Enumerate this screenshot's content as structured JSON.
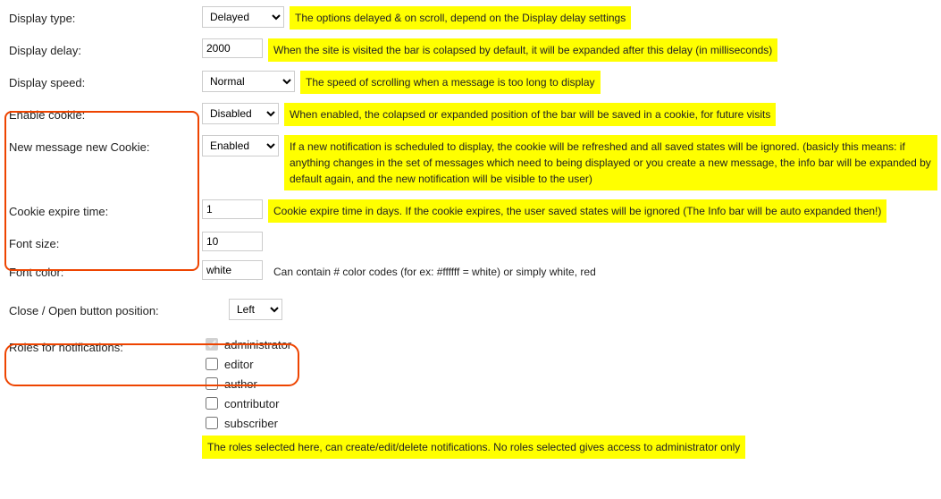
{
  "rows": {
    "displayType": {
      "label": "Display type:",
      "value": "Delayed",
      "hint": "The options delayed & on scroll, depend on the Display delay settings"
    },
    "displayDelay": {
      "label": "Display delay:",
      "value": "2000",
      "hint": "When the site is visited the bar is colapsed by default, it will be expanded after this delay (in milliseconds)"
    },
    "displaySpeed": {
      "label": "Display speed:",
      "value": "Normal",
      "hint": "The speed of scrolling when a message is too long to display"
    },
    "enableCookie": {
      "label": "Enable cookie:",
      "value": "Disabled",
      "hint": "When enabled, the colapsed or expanded position of the bar will be saved in a cookie, for future visits"
    },
    "newMsgCookie": {
      "label": "New message new Cookie:",
      "value": "Enabled",
      "hint": "If a new notification is scheduled to display, the cookie will be refreshed and all saved states will be ignored. (basicly this means: if anything changes in the set of messages which need to being displayed or you create a new message, the info bar will be expanded by default again, and the new notification will be visible to the user)"
    },
    "cookieExpire": {
      "label": "Cookie expire time:",
      "value": "1",
      "hint": "Cookie expire time in days. If the cookie expires, the user saved states will be ignored (The Info bar will be auto expanded then!)"
    },
    "fontSize": {
      "label": "Font size:",
      "value": "10"
    },
    "fontColor": {
      "label": "Font color:",
      "value": "white",
      "hint": "Can contain # color codes (for ex: #ffffff = white) or simply white, red"
    },
    "closeOpenPos": {
      "label": "Close / Open button position:",
      "value": "Left"
    },
    "roles": {
      "label": "Roles for notifications:",
      "items": [
        "administrator",
        "editor",
        "author",
        "contributor",
        "subscriber"
      ],
      "hint": "The roles selected here, can create/edit/delete notifications. No roles selected gives access to administrator only"
    }
  }
}
